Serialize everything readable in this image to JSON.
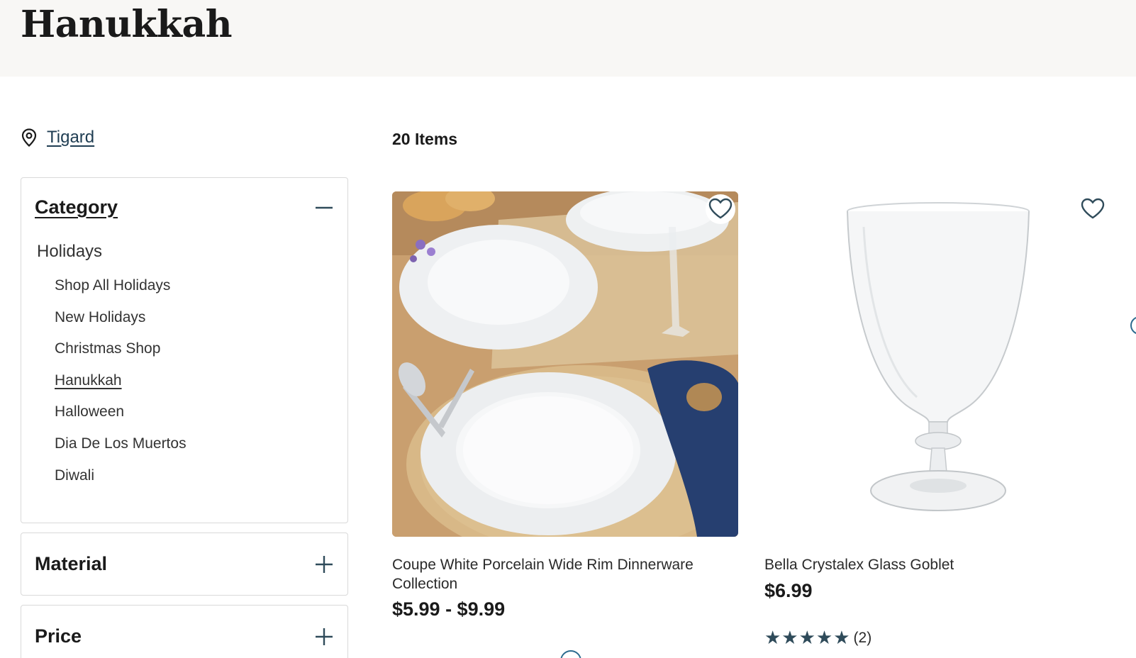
{
  "page": {
    "title": "Hanukkah"
  },
  "store": {
    "name": "Tigard"
  },
  "results": {
    "count_label": "20 Items"
  },
  "facets": {
    "category": {
      "title": "Category",
      "parent": "Holidays",
      "items": [
        {
          "label": "Shop All Holidays",
          "active": false
        },
        {
          "label": "New Holidays",
          "active": false
        },
        {
          "label": "Christmas Shop",
          "active": false
        },
        {
          "label": "Hanukkah",
          "active": true
        },
        {
          "label": "Halloween",
          "active": false
        },
        {
          "label": "Dia De Los Muertos",
          "active": false
        },
        {
          "label": "Diwali",
          "active": false
        }
      ],
      "toggle_icon": "minus-icon"
    },
    "material": {
      "title": "Material",
      "toggle_icon": "plus-icon"
    },
    "price": {
      "title": "Price",
      "toggle_icon": "plus-icon"
    }
  },
  "products": [
    {
      "name": "Coupe White Porcelain Wide Rim Dinnerware Collection",
      "price": "$5.99 - $9.99",
      "image": "white-dinner-plates-photo"
    },
    {
      "name": "Bella Crystalex Glass Goblet",
      "price": "$6.99",
      "rating": {
        "stars": "★★★★★",
        "value": 5,
        "count": "(2)"
      },
      "image": "glass-goblet-photo"
    }
  ],
  "colors": {
    "banner_bg": "#f8f7f5",
    "link": "#1f3d52",
    "star": "#2f4b5a",
    "accent_ring": "#2c6b8f"
  }
}
